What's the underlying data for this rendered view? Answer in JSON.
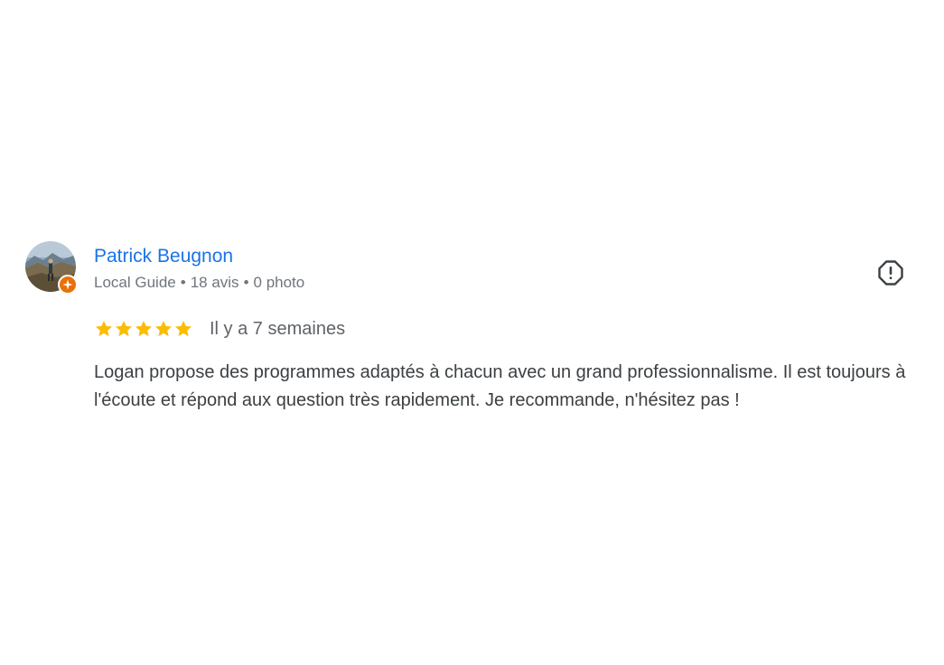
{
  "review": {
    "author": {
      "name": "Patrick Beugnon",
      "badge": "Local Guide",
      "reviews_count": "18 avis",
      "photos_count": "0 photo",
      "separator": "•",
      "avatar_icon": "avatar-photo-icon",
      "badge_icon": "local-guide-star-icon"
    },
    "rating": {
      "stars": 5,
      "max": 5,
      "color": "#fbbc04"
    },
    "date": "Il y a 7 semaines",
    "text": "Logan propose des programmes adaptés à chacun avec un grand professionnalisme. Il est toujours à l'écoute et répond aux question très rapidement. Je recommande, n'hésitez pas !",
    "report_icon": "report-flag-icon"
  },
  "colors": {
    "author_link": "#1a73e8",
    "meta_text": "#70757a",
    "body_text": "#3c4043",
    "guide_badge": "#e8710a"
  }
}
